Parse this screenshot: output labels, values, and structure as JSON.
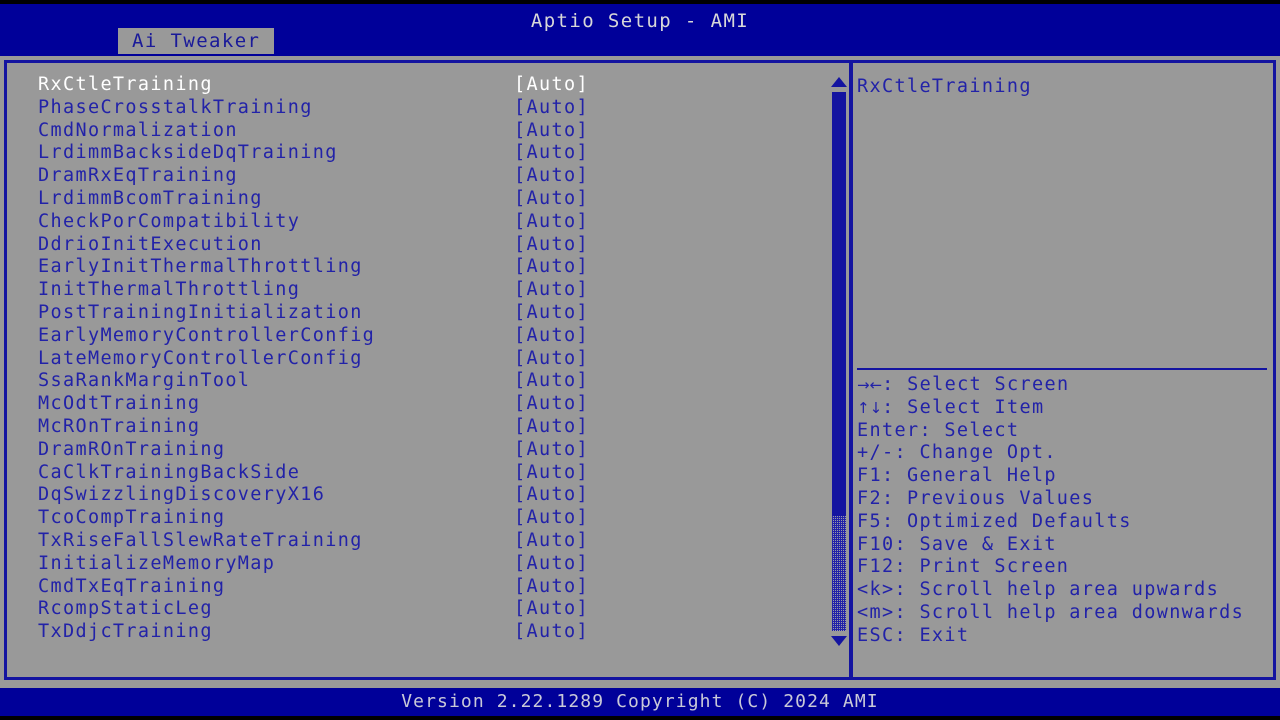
{
  "header": {
    "title": "Aptio Setup - AMI",
    "tab_label": "Ai Tweaker"
  },
  "colors": {
    "background": "#999999",
    "header_blue": "#000099",
    "text_blue": "#2222a8",
    "selected_text": "#ffffff",
    "border_blue": "#1414a0"
  },
  "options": {
    "value_auto": "[Auto]",
    "selected_index": 0,
    "items": [
      {
        "name": "RxCtleTraining",
        "value": "[Auto]"
      },
      {
        "name": "PhaseCrosstalkTraining",
        "value": "[Auto]"
      },
      {
        "name": "CmdNormalization",
        "value": "[Auto]"
      },
      {
        "name": "LrdimmBacksideDqTraining",
        "value": "[Auto]"
      },
      {
        "name": "DramRxEqTraining",
        "value": "[Auto]"
      },
      {
        "name": "LrdimmBcomTraining",
        "value": "[Auto]"
      },
      {
        "name": "CheckPorCompatibility",
        "value": "[Auto]"
      },
      {
        "name": "DdrioInitExecution",
        "value": "[Auto]"
      },
      {
        "name": "EarlyInitThermalThrottling",
        "value": "[Auto]"
      },
      {
        "name": "InitThermalThrottling",
        "value": "[Auto]"
      },
      {
        "name": "PostTrainingInitialization",
        "value": "[Auto]"
      },
      {
        "name": "EarlyMemoryControllerConfig",
        "value": "[Auto]"
      },
      {
        "name": "LateMemoryControllerConfig",
        "value": "[Auto]"
      },
      {
        "name": "SsaRankMarginTool",
        "value": "[Auto]"
      },
      {
        "name": "McOdtTraining",
        "value": "[Auto]"
      },
      {
        "name": "McROnTraining",
        "value": "[Auto]"
      },
      {
        "name": "DramROnTraining",
        "value": "[Auto]"
      },
      {
        "name": "CaClkTrainingBackSide",
        "value": "[Auto]"
      },
      {
        "name": "DqSwizzlingDiscoveryX16",
        "value": "[Auto]"
      },
      {
        "name": "TcoCompTraining",
        "value": "[Auto]"
      },
      {
        "name": "TxRiseFallSlewRateTraining",
        "value": "[Auto]"
      },
      {
        "name": "InitializeMemoryMap",
        "value": "[Auto]"
      },
      {
        "name": "CmdTxEqTraining",
        "value": "[Auto]"
      },
      {
        "name": "RcompStaticLeg",
        "value": "[Auto]"
      },
      {
        "name": "TxDdjcTraining",
        "value": "[Auto]"
      }
    ]
  },
  "scrollbar": {
    "up_arrow": "scroll-up-arrow",
    "down_arrow": "scroll-down-arrow"
  },
  "help": {
    "title": "RxCtleTraining",
    "description": "",
    "keys": [
      {
        "glyph": "→←",
        "text": ": Select Screen"
      },
      {
        "glyph": "↑↓",
        "text": ": Select Item"
      },
      {
        "glyph": "",
        "text": "Enter: Select"
      },
      {
        "glyph": "",
        "text": "+/-: Change Opt."
      },
      {
        "glyph": "",
        "text": "F1: General Help"
      },
      {
        "glyph": "",
        "text": "F2: Previous Values"
      },
      {
        "glyph": "",
        "text": "F5: Optimized Defaults"
      },
      {
        "glyph": "",
        "text": "F10: Save & Exit"
      },
      {
        "glyph": "",
        "text": "F12: Print Screen"
      },
      {
        "glyph": "",
        "text": "<k>: Scroll help area upwards"
      },
      {
        "glyph": "",
        "text": "<m>: Scroll help area downwards"
      },
      {
        "glyph": "",
        "text": "ESC: Exit"
      }
    ]
  },
  "footer": {
    "version_text": "Version 2.22.1289 Copyright (C) 2024 AMI"
  }
}
